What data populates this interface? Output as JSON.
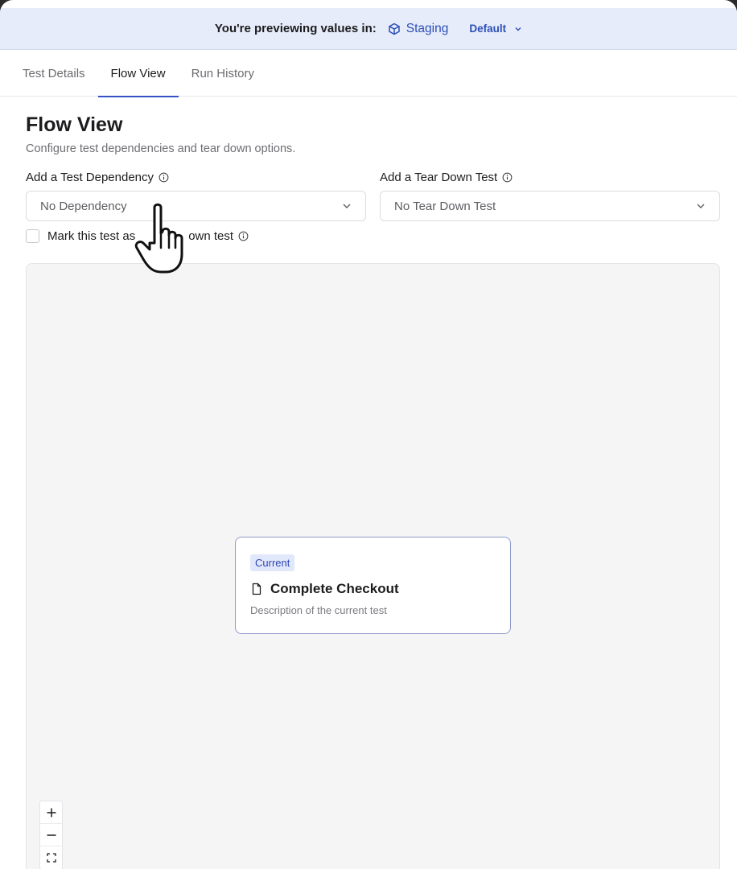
{
  "preview_bar": {
    "label": "You're previewing values in:",
    "environment": "Staging",
    "variant": "Default"
  },
  "tabs": [
    {
      "label": "Test Details",
      "active": false
    },
    {
      "label": "Flow View",
      "active": true
    },
    {
      "label": "Run History",
      "active": false
    }
  ],
  "page": {
    "title": "Flow View",
    "subtitle": "Configure test dependencies and tear down options."
  },
  "dependency": {
    "label": "Add a Test Dependency",
    "value": "No Dependency"
  },
  "teardown": {
    "label": "Add a Tear Down Test",
    "value": "No Tear Down Test"
  },
  "checkbox": {
    "label_before": "Mark this test as",
    "label_after": "own test"
  },
  "node": {
    "badge": "Current",
    "title": "Complete Checkout",
    "description": "Description of the current test"
  },
  "icons": {
    "environment": "cube-icon",
    "info": "info-icon",
    "chevron": "chevron-down-icon",
    "file": "file-icon",
    "zoom_in": "plus-icon",
    "zoom_out": "minus-icon",
    "fit": "fit-view-icon",
    "cursor": "hand-pointer-icon"
  },
  "colors": {
    "accent": "#3552c4",
    "preview_bar_bg": "#e6ecf9",
    "canvas_bg": "#f5f5f6"
  }
}
